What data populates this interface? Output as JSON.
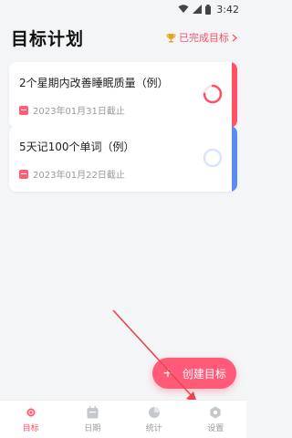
{
  "status_bar": {
    "time": "3:42"
  },
  "header": {
    "title": "目标计划",
    "completed_label": "已完成目标"
  },
  "goals": [
    {
      "title": "2个星期内改善睡眠质量（例）",
      "deadline": "2023年01月31日截止",
      "accent_color": "#ff5066",
      "progress": 0.75
    },
    {
      "title": "5天记100个单词（例）",
      "deadline": "2023年01月22日截止",
      "accent_color": "#5a8dee",
      "progress": 0
    }
  ],
  "create_button": {
    "label": "创建目标"
  },
  "tabs": [
    {
      "label": "目标",
      "icon": "target-icon",
      "active": true
    },
    {
      "label": "日期",
      "icon": "calendar-icon",
      "active": false
    },
    {
      "label": "统计",
      "icon": "pie-chart-icon",
      "active": false
    },
    {
      "label": "设置",
      "icon": "settings-icon",
      "active": false
    }
  ],
  "colors": {
    "accent": "#ff5066",
    "blue": "#5a8dee",
    "annotation_arrow": "#e8474f"
  }
}
